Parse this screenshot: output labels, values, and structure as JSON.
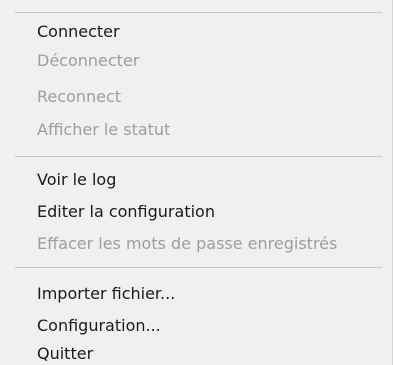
{
  "menu": {
    "items": [
      {
        "label": "Connecter",
        "enabled": true
      },
      {
        "label": "Déconnecter",
        "enabled": false
      },
      {
        "label": "Reconnect",
        "enabled": false
      },
      {
        "label": "Afficher le statut",
        "enabled": false
      },
      {
        "label": "Voir le log",
        "enabled": true
      },
      {
        "label": "Editer la configuration",
        "enabled": true
      },
      {
        "label": "Effacer les mots de passe enregistrés",
        "enabled": false
      },
      {
        "label": "Importer fichier...",
        "enabled": true
      },
      {
        "label": "Configuration...",
        "enabled": true
      },
      {
        "label": "Quitter",
        "enabled": true
      }
    ]
  }
}
